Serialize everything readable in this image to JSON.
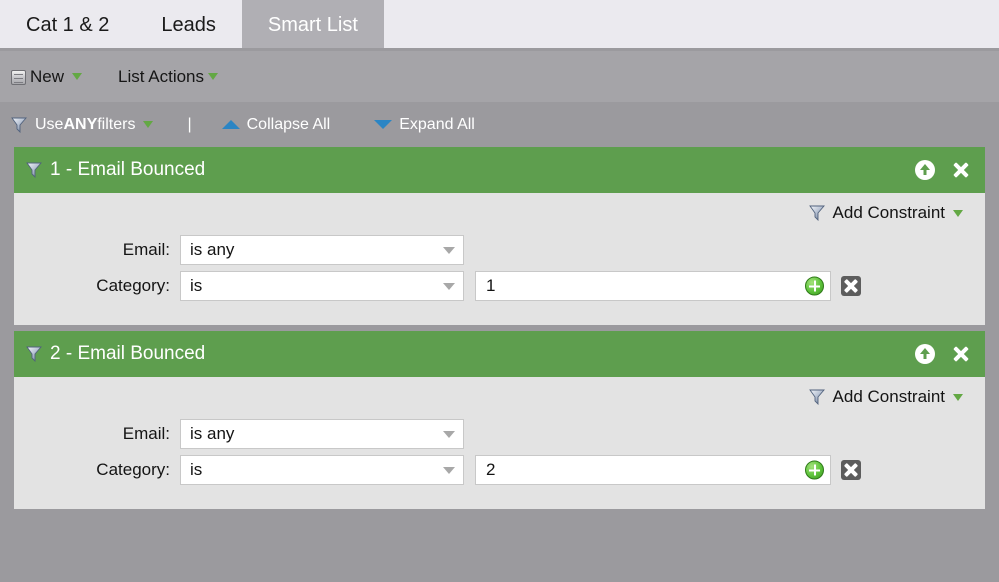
{
  "tabs": [
    {
      "label": "Cat 1 & 2",
      "active": false
    },
    {
      "label": "Leads",
      "active": false
    },
    {
      "label": "Smart List",
      "active": true
    }
  ],
  "toolbar": {
    "new_label": "New",
    "list_actions_label": "List Actions"
  },
  "filterbar": {
    "use_prefix": "Use ",
    "use_emphasis": "ANY",
    "use_suffix": " filters",
    "separator": "|",
    "collapse_all_label": "Collapse All",
    "expand_all_label": "Expand All"
  },
  "labels": {
    "add_constraint": "Add Constraint",
    "email": "Email:",
    "category": "Category:"
  },
  "colors": {
    "panel_header_green": "#5e9e4e",
    "toolbar_gray": "#a5a4a8",
    "filterbar_gray": "#9b9a9e",
    "tabbar_light": "#ebeaef",
    "active_tab_gray": "#b0afb4",
    "panel_body_gray": "#e3e3e3",
    "caret_green": "#63a844",
    "triangle_blue": "#2b85c4",
    "add_button_green": "#5cc23a"
  },
  "panels": [
    {
      "title": "1 - Email Bounced",
      "email_operator": "is any",
      "category_operator": "is",
      "category_value": "1"
    },
    {
      "title": "2 - Email Bounced",
      "email_operator": "is any",
      "category_operator": "is",
      "category_value": "2"
    }
  ]
}
